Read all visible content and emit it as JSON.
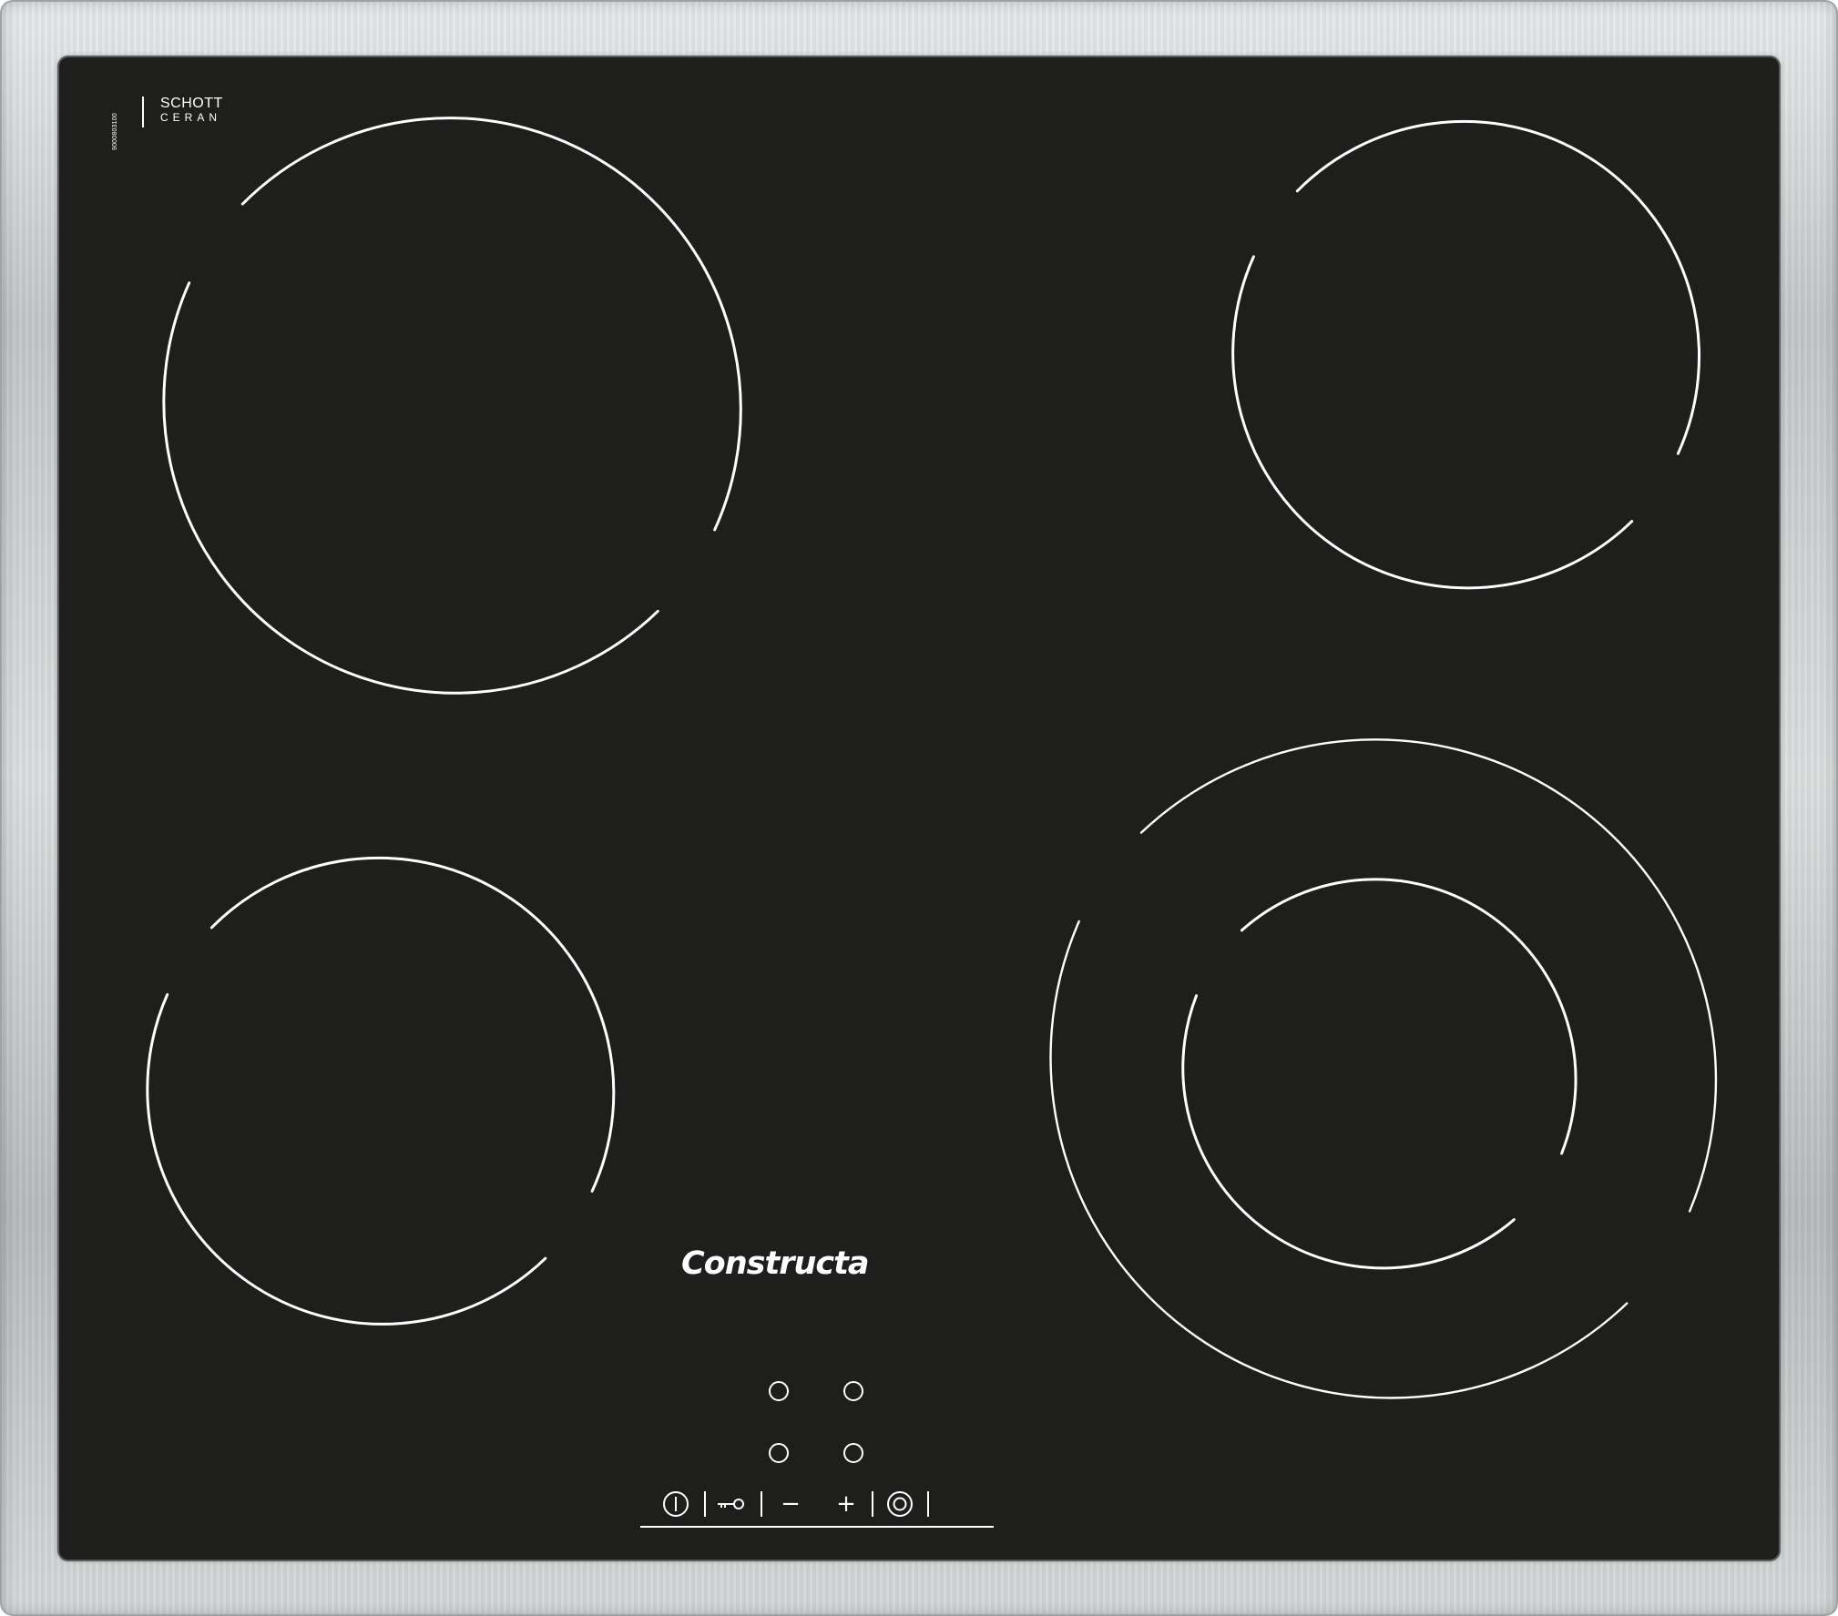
{
  "product": {
    "brand": "Constructa",
    "glass_maker_line1": "SCHOTT",
    "glass_maker_line2": "CERAN",
    "serial_number": "9000803100"
  },
  "controls": {
    "minus_label": "−",
    "plus_label": "+"
  },
  "colors": {
    "glass": "#1e1e1c",
    "markings": "#ffffff",
    "frame": "#c9cbcd"
  }
}
